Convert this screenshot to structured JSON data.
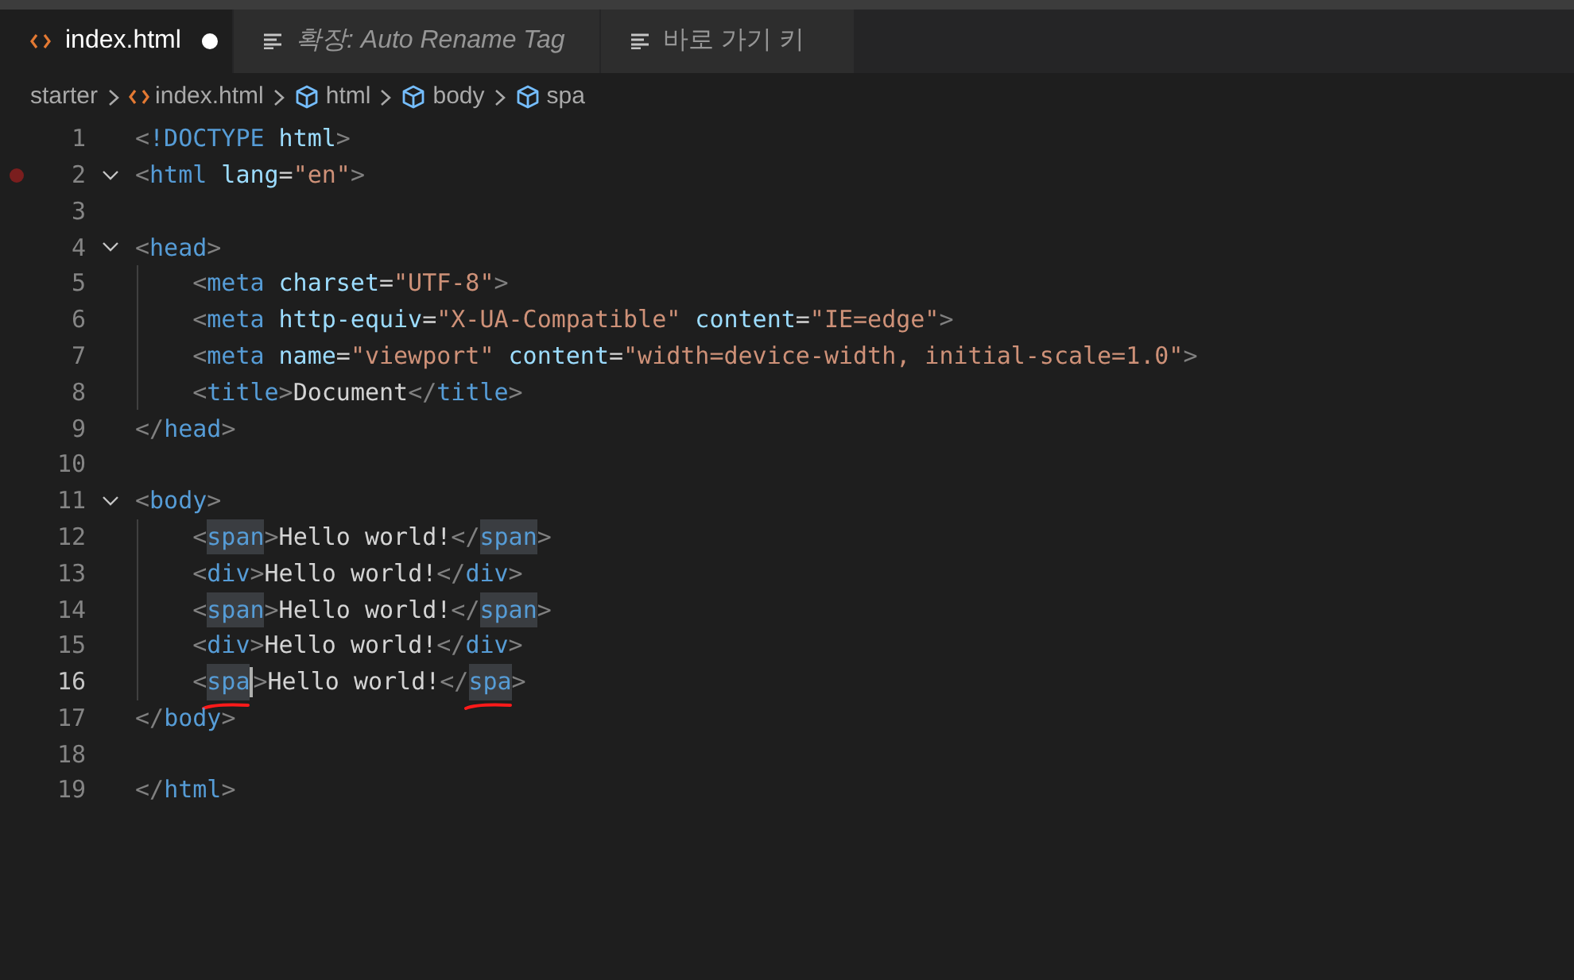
{
  "tabs": [
    {
      "kind": "file",
      "label": "index.html",
      "selected": true,
      "modified": true,
      "italic": false
    },
    {
      "kind": "preview",
      "label": "확장: Auto Rename Tag",
      "selected": false,
      "modified": false,
      "italic": true
    },
    {
      "kind": "preview",
      "label": "바로 가기 키",
      "selected": false,
      "modified": false,
      "italic": false
    }
  ],
  "breadcrumbs": [
    {
      "kind": "folder",
      "label": "starter"
    },
    {
      "kind": "file",
      "label": "index.html"
    },
    {
      "kind": "element",
      "label": "html"
    },
    {
      "kind": "element",
      "label": "body"
    },
    {
      "kind": "element",
      "label": "spa"
    }
  ],
  "lines": [
    {
      "number": "1",
      "fold": false,
      "breakpoint": false,
      "active": false,
      "indented": false,
      "tokens": [
        {
          "kind": "punct",
          "text": "<"
        },
        {
          "kind": "tag",
          "text": "!DOCTYPE"
        },
        {
          "kind": "attr",
          "text": "html",
          "spaced": true
        },
        {
          "kind": "punct",
          "text": ">"
        }
      ]
    },
    {
      "number": "2",
      "fold": true,
      "breakpoint": true,
      "active": false,
      "indented": false,
      "tokens": [
        {
          "kind": "punct",
          "text": "<"
        },
        {
          "kind": "tag",
          "text": "html"
        },
        {
          "kind": "attr",
          "text": "lang",
          "spaced": true
        },
        {
          "kind": "op",
          "text": "="
        },
        {
          "kind": "str",
          "text": "\"en\""
        },
        {
          "kind": "punct",
          "text": ">"
        }
      ]
    },
    {
      "number": "3",
      "fold": false,
      "breakpoint": false,
      "active": false,
      "indented": false
    },
    {
      "number": "4",
      "fold": true,
      "breakpoint": false,
      "active": false,
      "indented": false,
      "tokens": [
        {
          "kind": "punct",
          "text": "<"
        },
        {
          "kind": "tag",
          "text": "head"
        },
        {
          "kind": "punct",
          "text": ">"
        }
      ]
    },
    {
      "number": "5",
      "fold": false,
      "breakpoint": false,
      "active": false,
      "indented": true,
      "tokens": [
        {
          "kind": "punct",
          "text": "<"
        },
        {
          "kind": "tag",
          "text": "meta"
        },
        {
          "kind": "attr",
          "text": "charset",
          "spaced": true
        },
        {
          "kind": "op",
          "text": "="
        },
        {
          "kind": "str",
          "text": "\"UTF-8\""
        },
        {
          "kind": "punct",
          "text": ">"
        }
      ]
    },
    {
      "number": "6",
      "fold": false,
      "breakpoint": false,
      "active": false,
      "indented": true,
      "tokens": [
        {
          "kind": "punct",
          "text": "<"
        },
        {
          "kind": "tag",
          "text": "meta"
        },
        {
          "kind": "attr",
          "text": "http-equiv",
          "spaced": true
        },
        {
          "kind": "op",
          "text": "="
        },
        {
          "kind": "str",
          "text": "\"X-UA-Compatible\""
        },
        {
          "kind": "attr",
          "text": "content",
          "spaced": true
        },
        {
          "kind": "op",
          "text": "="
        },
        {
          "kind": "str",
          "text": "\"IE=edge\""
        },
        {
          "kind": "punct",
          "text": ">"
        }
      ]
    },
    {
      "number": "7",
      "fold": false,
      "breakpoint": false,
      "active": false,
      "indented": true,
      "tokens": [
        {
          "kind": "punct",
          "text": "<"
        },
        {
          "kind": "tag",
          "text": "meta"
        },
        {
          "kind": "attr",
          "text": "name",
          "spaced": true
        },
        {
          "kind": "op",
          "text": "="
        },
        {
          "kind": "str",
          "text": "\"viewport\""
        },
        {
          "kind": "attr",
          "text": "content",
          "spaced": true
        },
        {
          "kind": "op",
          "text": "="
        },
        {
          "kind": "str",
          "text": "\"width=device-width, initial-scale=1.0\""
        },
        {
          "kind": "punct",
          "text": ">"
        }
      ]
    },
    {
      "number": "8",
      "fold": false,
      "breakpoint": false,
      "active": false,
      "indented": true,
      "tokens": [
        {
          "kind": "punct",
          "text": "<"
        },
        {
          "kind": "tag",
          "text": "title"
        },
        {
          "kind": "punct",
          "text": ">"
        },
        {
          "kind": "text",
          "text": "Document"
        },
        {
          "kind": "punct",
          "text": "</"
        },
        {
          "kind": "tag",
          "text": "title"
        },
        {
          "kind": "punct",
          "text": ">"
        }
      ]
    },
    {
      "number": "9",
      "fold": false,
      "breakpoint": false,
      "active": false,
      "indented": false,
      "tokens": [
        {
          "kind": "punct",
          "text": "</"
        },
        {
          "kind": "tag",
          "text": "head"
        },
        {
          "kind": "punct",
          "text": ">"
        }
      ]
    },
    {
      "number": "10",
      "fold": false,
      "breakpoint": false,
      "active": false,
      "indented": false
    },
    {
      "number": "11",
      "fold": true,
      "breakpoint": false,
      "active": false,
      "indented": false,
      "tokens": [
        {
          "kind": "punct",
          "text": "<"
        },
        {
          "kind": "tag",
          "text": "body"
        },
        {
          "kind": "punct",
          "text": ">"
        }
      ]
    },
    {
      "number": "12",
      "fold": false,
      "breakpoint": false,
      "active": false,
      "indented": true,
      "tokens": [
        {
          "kind": "punct",
          "text": "<"
        },
        {
          "kind": "tag",
          "text": "span",
          "highlighted": true
        },
        {
          "kind": "punct",
          "text": ">"
        },
        {
          "kind": "text",
          "text": "Hello world!"
        },
        {
          "kind": "punct",
          "text": "</"
        },
        {
          "kind": "tag",
          "text": "span",
          "highlighted": true
        },
        {
          "kind": "punct",
          "text": ">"
        }
      ]
    },
    {
      "number": "13",
      "fold": false,
      "breakpoint": false,
      "active": false,
      "indented": true,
      "tokens": [
        {
          "kind": "punct",
          "text": "<"
        },
        {
          "kind": "tag",
          "text": "div"
        },
        {
          "kind": "punct",
          "text": ">"
        },
        {
          "kind": "text",
          "text": "Hello world!"
        },
        {
          "kind": "punct",
          "text": "</"
        },
        {
          "kind": "tag",
          "text": "div"
        },
        {
          "kind": "punct",
          "text": ">"
        }
      ]
    },
    {
      "number": "14",
      "fold": false,
      "breakpoint": false,
      "active": false,
      "indented": true,
      "tokens": [
        {
          "kind": "punct",
          "text": "<"
        },
        {
          "kind": "tag",
          "text": "span",
          "highlighted": true
        },
        {
          "kind": "punct",
          "text": ">"
        },
        {
          "kind": "text",
          "text": "Hello world!"
        },
        {
          "kind": "punct",
          "text": "</"
        },
        {
          "kind": "tag",
          "text": "span",
          "highlighted": true
        },
        {
          "kind": "punct",
          "text": ">"
        }
      ]
    },
    {
      "number": "15",
      "fold": false,
      "breakpoint": false,
      "active": false,
      "indented": true,
      "tokens": [
        {
          "kind": "punct",
          "text": "<"
        },
        {
          "kind": "tag",
          "text": "div"
        },
        {
          "kind": "punct",
          "text": ">"
        },
        {
          "kind": "text",
          "text": "Hello world!"
        },
        {
          "kind": "punct",
          "text": "</"
        },
        {
          "kind": "tag",
          "text": "div"
        },
        {
          "kind": "punct",
          "text": ">"
        }
      ]
    },
    {
      "number": "16",
      "fold": false,
      "breakpoint": false,
      "active": true,
      "indented": true,
      "tokens": [
        {
          "kind": "punct",
          "text": "<"
        },
        {
          "kind": "tag",
          "text": "spa",
          "highlighted": true,
          "underlined": true,
          "cursor_after": true
        },
        {
          "kind": "punct",
          "text": ">"
        },
        {
          "kind": "text",
          "text": "Hello world!"
        },
        {
          "kind": "punct",
          "text": "</"
        },
        {
          "kind": "tag",
          "text": "spa",
          "highlighted": true,
          "underlined": true
        },
        {
          "kind": "punct",
          "text": ">"
        }
      ]
    },
    {
      "number": "17",
      "fold": false,
      "breakpoint": false,
      "active": false,
      "indented": false,
      "tokens": [
        {
          "kind": "punct",
          "text": "</"
        },
        {
          "kind": "tag",
          "text": "body"
        },
        {
          "kind": "punct",
          "text": ">"
        }
      ]
    },
    {
      "number": "18",
      "fold": false,
      "breakpoint": false,
      "active": false,
      "indented": false
    },
    {
      "number": "19",
      "fold": false,
      "breakpoint": false,
      "active": false,
      "indented": false,
      "tokens": [
        {
          "kind": "punct",
          "text": "</"
        },
        {
          "kind": "tag",
          "text": "html"
        },
        {
          "kind": "punct",
          "text": ">"
        }
      ]
    }
  ]
}
